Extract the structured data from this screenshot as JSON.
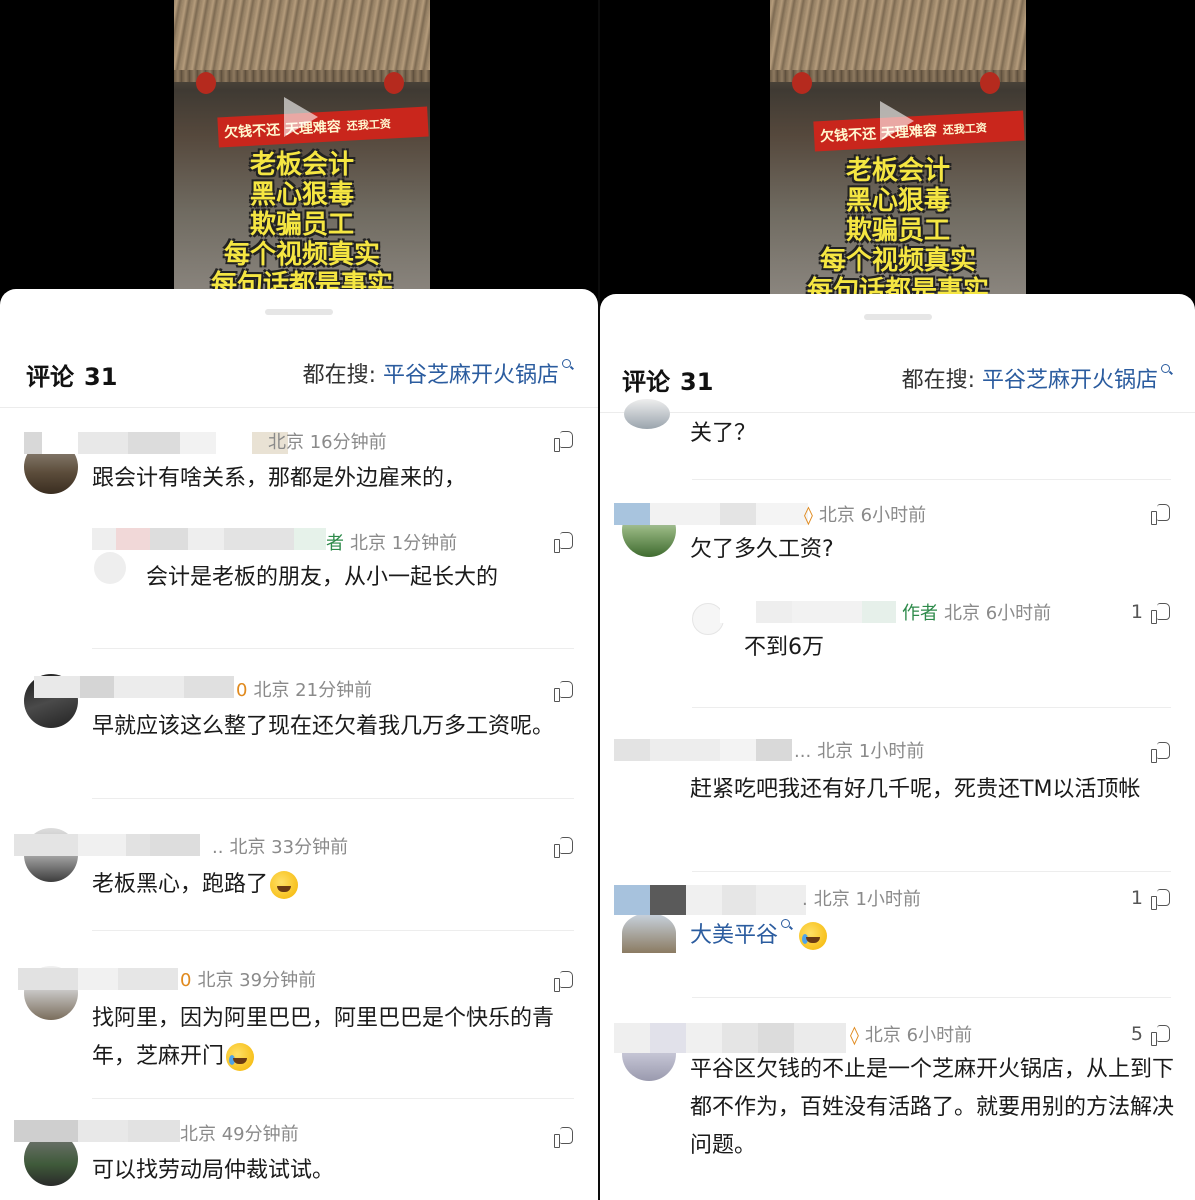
{
  "video": {
    "banner_main": "欠钱不还 天理难容",
    "banner_small": "还我工资",
    "lines": [
      "老板会计",
      "黑心狠毒",
      "欺骗员工",
      "每个视频真实",
      "每句话都是事实"
    ]
  },
  "header": {
    "comments_label": "评论",
    "comments_count": "31",
    "search_prefix": "都在搜:",
    "search_term": "平谷芝麻开火锅店"
  },
  "left_comments": [
    {
      "meta": "北京 16分钟前",
      "text": "跟会计有啥关系，那都是外边雇来的，"
    },
    {
      "tag": "者",
      "meta": "北京 1分钟前",
      "text": "会计是老板的朋友，从小一起长大的"
    },
    {
      "prefix": "0",
      "meta": "北京 21分钟前",
      "text": "早就应该这么整了现在还欠着我几万多工资呢。"
    },
    {
      "prefix": "..",
      "meta": "北京 33分钟前",
      "text": "老板黑心，跑路了"
    },
    {
      "prefix": "0",
      "meta": "北京 39分钟前",
      "text": "找阿里，因为阿里巴巴，阿里巴巴是个快乐的青年，芝麻开门"
    },
    {
      "meta": "北京 49分钟前",
      "meta_partial": "北京 49分钟前",
      "text": "可以找劳动局仲裁试试。"
    }
  ],
  "right_comments": [
    {
      "text": "关了？"
    },
    {
      "meta": "北京 6小时前",
      "text": "欠了多久工资?"
    },
    {
      "tag": "作者",
      "meta": "北京 6小时前",
      "likes": "1",
      "text": "不到6万"
    },
    {
      "prefix": "...",
      "meta": "北京 1小时前",
      "text": "赶紧吃吧我还有好几千呢，死贵还TM以活顶帐"
    },
    {
      "prefix": ".",
      "meta": "北京 1小时前",
      "likes": "1",
      "text": "大美平谷"
    },
    {
      "meta": "北京 6小时前",
      "likes": "5",
      "text": "平谷区欠钱的不止是一个芝麻开火锅店，从上到下都不作为，百姓没有活路了。就要用别的方法解决问题。"
    }
  ],
  "icons": {
    "like": "thumbs-up-icon",
    "search": "search-icon"
  },
  "colors": {
    "link": "#2b5c9f",
    "author_tag": "#2d8a4a",
    "meta": "#8a8a8a"
  }
}
